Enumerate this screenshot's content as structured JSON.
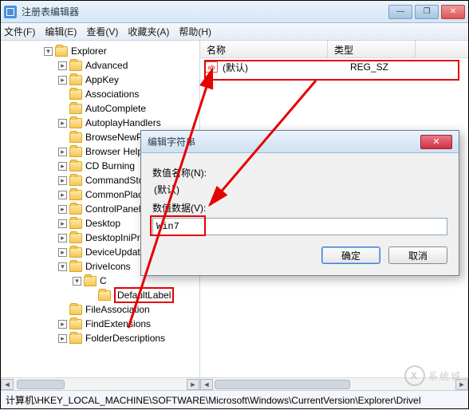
{
  "window": {
    "title": "注册表编辑器",
    "min_label": "—",
    "max_label": "❐",
    "close_label": "✕"
  },
  "menu": {
    "file": "文件(F)",
    "edit": "编辑(E)",
    "view": "查看(V)",
    "favorites": "收藏夹(A)",
    "help": "帮助(H)"
  },
  "tree": {
    "items": [
      {
        "label": "Explorer",
        "exp": "▾",
        "ind": 1
      },
      {
        "label": "Advanced",
        "exp": "▸",
        "ind": 2
      },
      {
        "label": "AppKey",
        "exp": "▸",
        "ind": 2
      },
      {
        "label": "Associations",
        "exp": "",
        "ind": 2
      },
      {
        "label": "AutoComplete",
        "exp": "",
        "ind": 2
      },
      {
        "label": "AutoplayHandlers",
        "exp": "▸",
        "ind": 2
      },
      {
        "label": "BrowseNewProcess",
        "exp": "",
        "ind": 2
      },
      {
        "label": "Browser Helper Objects",
        "exp": "▸",
        "ind": 2
      },
      {
        "label": "CD Burning",
        "exp": "▸",
        "ind": 2
      },
      {
        "label": "CommandStore",
        "exp": "▸",
        "ind": 2
      },
      {
        "label": "CommonPlaces",
        "exp": "▸",
        "ind": 2
      },
      {
        "label": "ControlPanel",
        "exp": "▸",
        "ind": 2
      },
      {
        "label": "Desktop",
        "exp": "▸",
        "ind": 2
      },
      {
        "label": "DesktopIniPropertyMap",
        "exp": "▸",
        "ind": 2
      },
      {
        "label": "DeviceUpdateLocations",
        "exp": "▸",
        "ind": 2
      },
      {
        "label": "DriveIcons",
        "exp": "▾",
        "ind": 2
      },
      {
        "label": "C",
        "exp": "▾",
        "ind": 3
      },
      {
        "label": "DefaultLabel",
        "exp": "",
        "ind": 4,
        "hl": true
      },
      {
        "label": "FileAssociation",
        "exp": "",
        "ind": 2
      },
      {
        "label": "FindExtensions",
        "exp": "▸",
        "ind": 2
      },
      {
        "label": "FolderDescriptions",
        "exp": "▸",
        "ind": 2
      }
    ]
  },
  "list": {
    "col_name": "名称",
    "col_type": "类型",
    "rows": [
      {
        "name": "(默认)",
        "type": "REG_SZ"
      }
    ]
  },
  "dialog": {
    "title": "编辑字符串",
    "name_label": "数值名称(N):",
    "name_value": "(默认)",
    "data_label": "数值数据(V):",
    "data_value": "Win7",
    "ok": "确定",
    "cancel": "取消",
    "close": "✕"
  },
  "status": {
    "path": "计算机\\HKEY_LOCAL_MACHINE\\SOFTWARE\\Microsoft\\Windows\\CurrentVersion\\Explorer\\DriveI"
  },
  "watermark": {
    "text": "系统城",
    "symbol": "X"
  }
}
